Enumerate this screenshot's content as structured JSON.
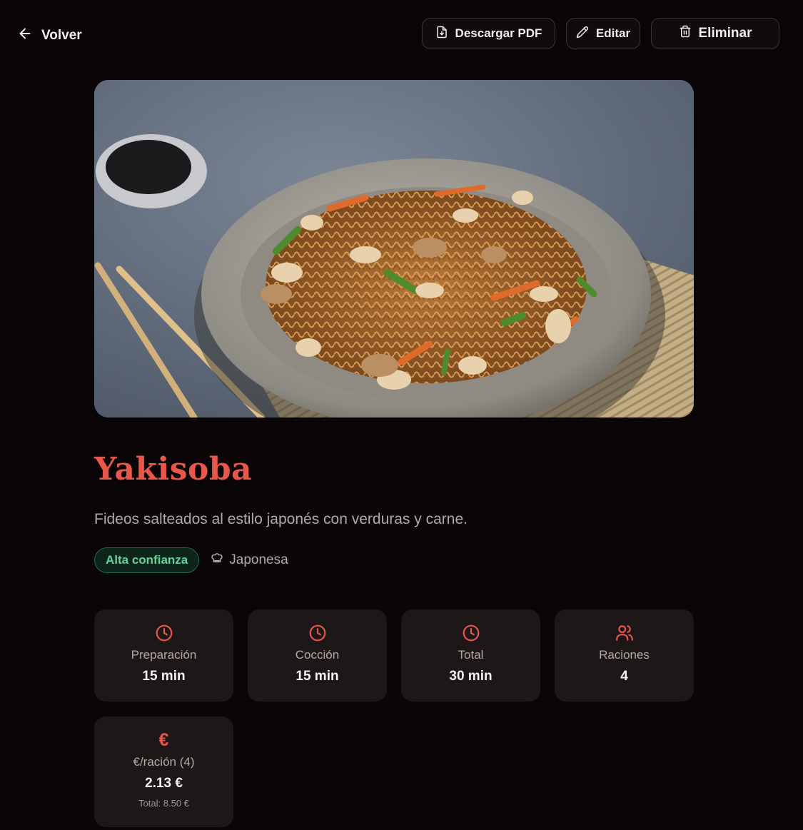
{
  "nav": {
    "back_label": "Volver"
  },
  "actions": {
    "download_label": "Descargar PDF",
    "edit_label": "Editar",
    "delete_label": "Eliminar"
  },
  "recipe": {
    "title": "Yakisoba",
    "description": "Fideos salteados al estilo japonés con verduras y carne.",
    "confidence_badge": "Alta confianza",
    "cuisine": "Japonesa"
  },
  "stats": [
    {
      "icon": "clock-icon",
      "label": "Preparación",
      "value": "15 min"
    },
    {
      "icon": "clock-icon",
      "label": "Cocción",
      "value": "15 min"
    },
    {
      "icon": "clock-icon",
      "label": "Total",
      "value": "30 min"
    },
    {
      "icon": "users-icon",
      "label": "Raciones",
      "value": "4"
    }
  ],
  "cost": {
    "icon": "euro-icon",
    "symbol": "€",
    "label": "€/ración (4)",
    "value": "2.13 €",
    "total": "Total: 8.50 €"
  },
  "colors": {
    "background": "#0a0506",
    "accent": "#e9574a",
    "card": "#1e1718",
    "badge_text": "#5fd39b"
  }
}
